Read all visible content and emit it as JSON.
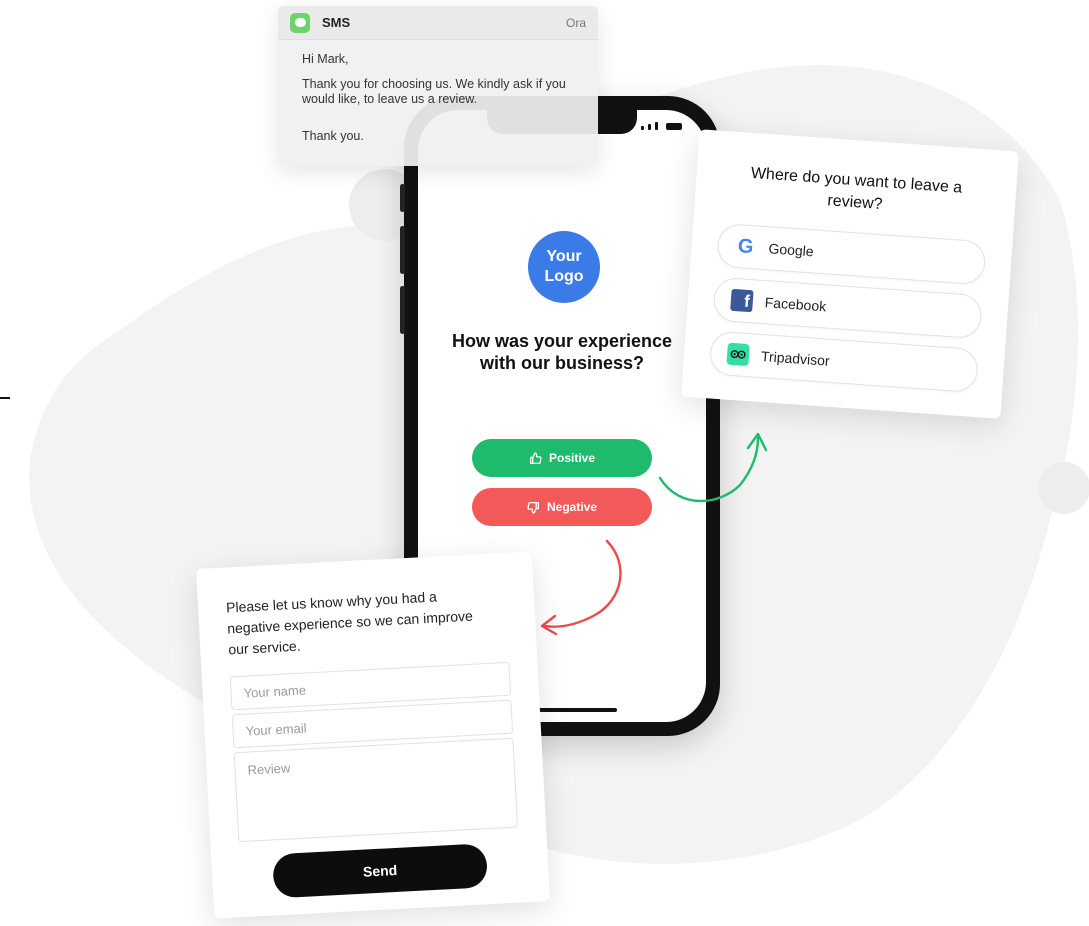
{
  "sms": {
    "icon": "message-icon",
    "title": "SMS",
    "time": "Ora",
    "greeting": "Hi Mark,",
    "message": "Thank you for choosing us. We kindly ask if you would like, to leave us a review.",
    "signoff": "Thank you."
  },
  "phone": {
    "logo": "Your Logo",
    "question": "How was your experience with our business?",
    "positive_label": "Positive",
    "negative_label": "Negative",
    "colors": {
      "logo": "#3b7be8",
      "positive": "#1dbb6b",
      "negative": "#f25a5a"
    }
  },
  "review": {
    "title": "Where do you want to leave a review?",
    "platforms": [
      {
        "name": "Google",
        "icon": "google-icon"
      },
      {
        "name": "Facebook",
        "icon": "facebook-icon"
      },
      {
        "name": "Tripadvisor",
        "icon": "tripadvisor-icon"
      }
    ]
  },
  "form": {
    "intro": "Please let us know why you had a negative experience so we can improve our service.",
    "name_placeholder": "Your name",
    "email_placeholder": "Your email",
    "review_placeholder": "Review",
    "send_label": "Send"
  }
}
